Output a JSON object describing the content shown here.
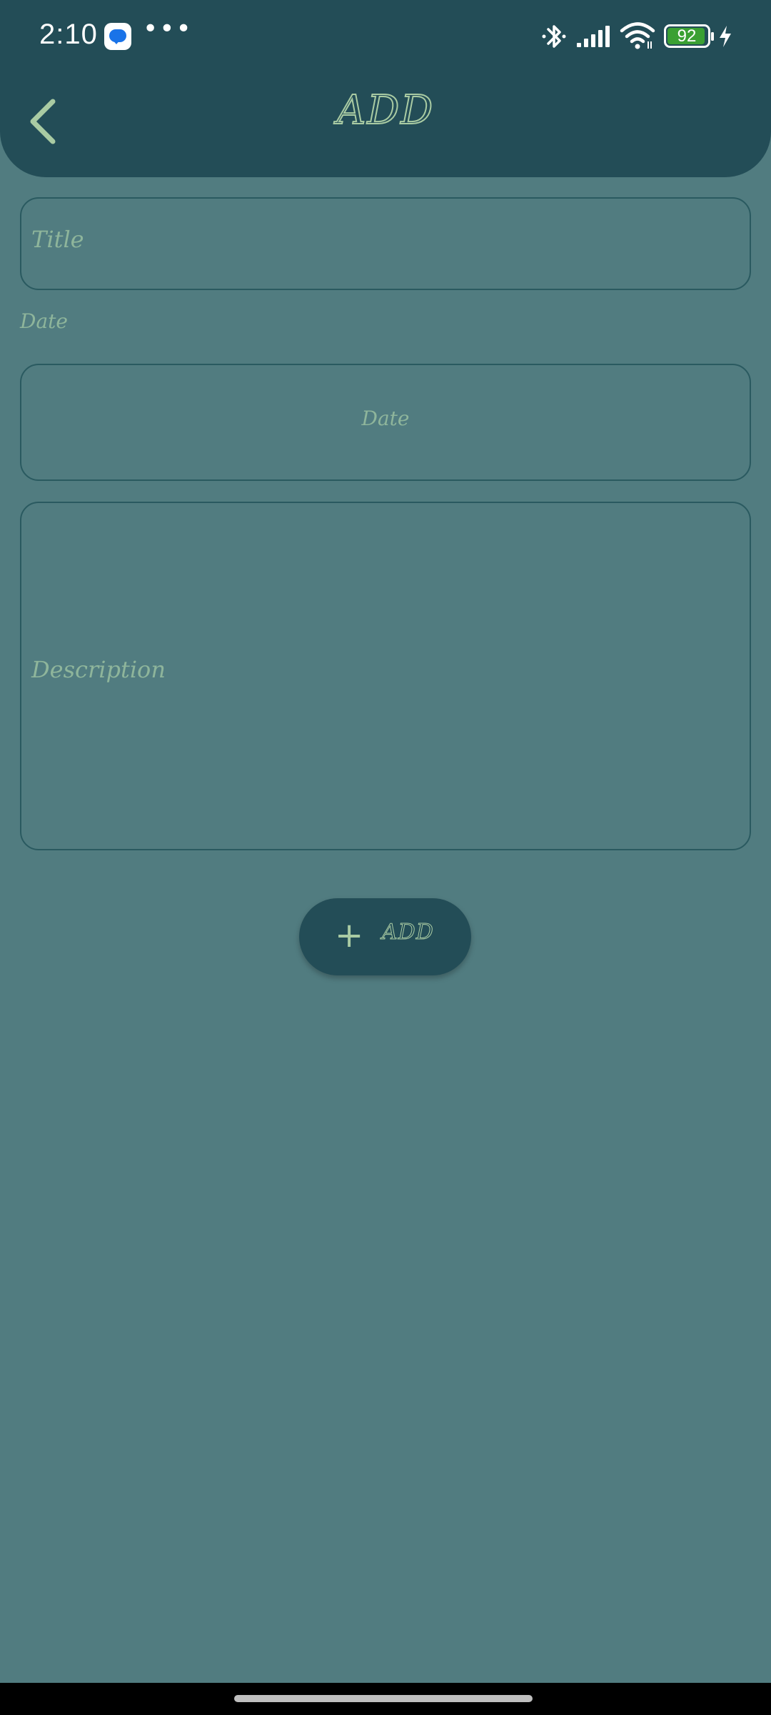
{
  "status_bar": {
    "time": "2:10",
    "more": "•••",
    "battery": "92"
  },
  "header": {
    "title": "ADD"
  },
  "form": {
    "title_placeholder": "Title",
    "date_label": "Date",
    "date_value": "Date",
    "description_placeholder": "Description"
  },
  "add_button": {
    "icon": "+",
    "label": "ADD"
  },
  "icons": {
    "back": "chevron-left-icon",
    "bluetooth": "bluetooth-icon",
    "signal": "signal-icon",
    "wifi": "wifi-icon",
    "battery": "battery-icon",
    "charging": "bolt-icon",
    "messages": "messages-app-icon"
  },
  "colors": {
    "background": "#517c80",
    "header": "#234d57",
    "accent": "#a9cba3",
    "placeholder": "#8eb59b",
    "battery_fill": "#3aa033"
  }
}
